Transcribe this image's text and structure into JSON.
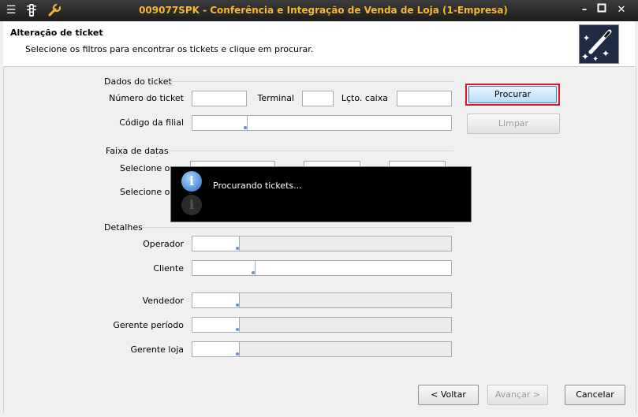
{
  "window": {
    "title": "009077SPK - Conferência e Integração de Venda de Loja (1-Empresa)",
    "icons": [
      "menu-icon",
      "traffic-light-icon",
      "tools-icon"
    ],
    "controls": [
      "minimize",
      "maximize",
      "close"
    ]
  },
  "header": {
    "title": "Alteração de ticket",
    "subtitle": "Selecione os filtros para encontrar os tickets e clique em procurar."
  },
  "dados_ticket": {
    "group_label": "Dados do ticket",
    "numero_label": "Número do ticket",
    "terminal_label": "Terminal",
    "lcto_label": "Lçto. caixa",
    "codigo_filial_label": "Código da filial"
  },
  "faixa_datas": {
    "group_label": "Faixa de datas",
    "selecione1_label": "Selecione o c",
    "selecione2_label": "Selecione o c"
  },
  "detalhes": {
    "group_label": "Detalhes",
    "operador_label": "Operador",
    "cliente_label": "Cliente",
    "vendedor_label": "Vendedor",
    "gerente_periodo_label": "Gerente período",
    "gerente_loja_label": "Gerente loja"
  },
  "buttons": {
    "procurar": "Procurar",
    "limpar": "Limpar",
    "voltar": "< Voltar",
    "avancar": "Avançar >",
    "cancelar": "Cancelar"
  },
  "popup": {
    "message": "Procurando tickets...",
    "icon": "info-icon"
  },
  "colors": {
    "title_text": "#f5b82e",
    "focus_border": "#d3182b",
    "popup_bg": "#000000"
  }
}
